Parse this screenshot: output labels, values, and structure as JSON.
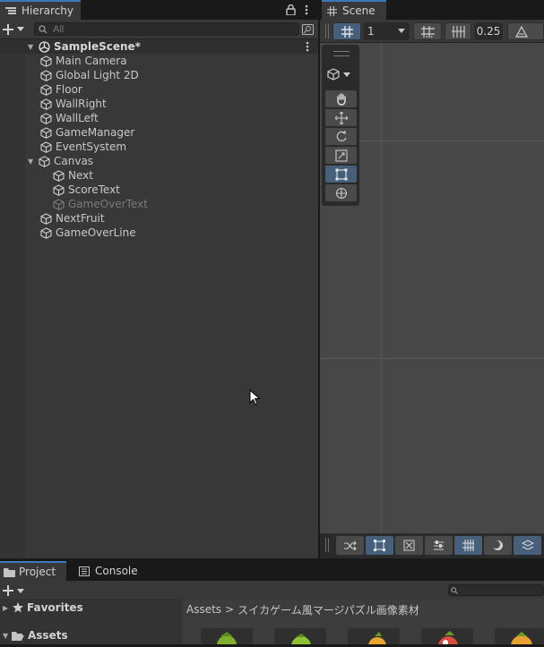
{
  "hierarchy": {
    "tab_label": "Hierarchy",
    "search_placeholder": "All",
    "scene_name": "SampleScene*",
    "items": [
      {
        "label": "Main Camera",
        "depth": 1,
        "enabled": true
      },
      {
        "label": "Global Light 2D",
        "depth": 1,
        "enabled": true
      },
      {
        "label": "Floor",
        "depth": 1,
        "enabled": true
      },
      {
        "label": "WallRight",
        "depth": 1,
        "enabled": true
      },
      {
        "label": "WallLeft",
        "depth": 1,
        "enabled": true
      },
      {
        "label": "GameManager",
        "depth": 1,
        "enabled": true
      },
      {
        "label": "EventSystem",
        "depth": 1,
        "enabled": true
      },
      {
        "label": "Canvas",
        "depth": 1,
        "enabled": true,
        "expanded": true
      },
      {
        "label": "Next",
        "depth": 2,
        "enabled": true
      },
      {
        "label": "ScoreText",
        "depth": 2,
        "enabled": true
      },
      {
        "label": "GameOverText",
        "depth": 2,
        "enabled": false
      },
      {
        "label": "NextFruit",
        "depth": 1,
        "enabled": true
      },
      {
        "label": "GameOverLine",
        "depth": 1,
        "enabled": true
      }
    ]
  },
  "scene": {
    "tab_label": "Scene",
    "grid_value": "1",
    "snap_value": "0.25"
  },
  "bottom": {
    "project_tab": "Project",
    "console_tab": "Console",
    "favorites": "Favorites",
    "assets": "Assets",
    "breadcrumb_root": "Assets",
    "breadcrumb_sep": ">",
    "breadcrumb_folder": "スイカゲーム風マージパズル画像素材"
  },
  "colors": {
    "accent": "#3a79bb",
    "active_button": "#46607c",
    "panel": "#383838"
  }
}
